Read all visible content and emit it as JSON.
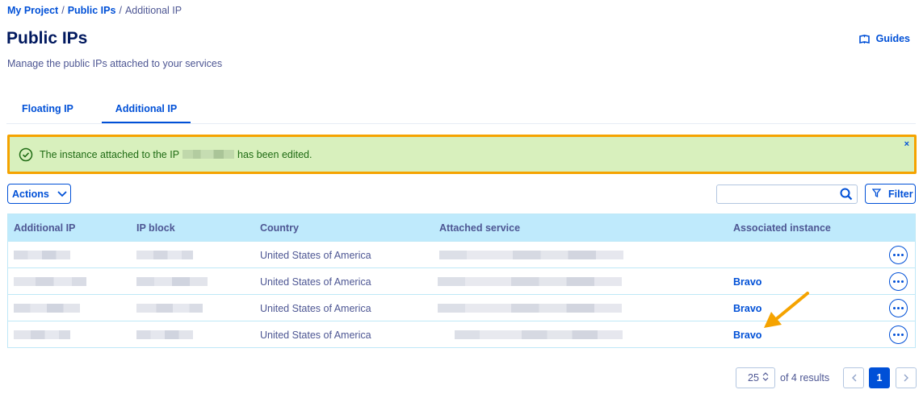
{
  "breadcrumb": {
    "items": [
      "My Project",
      "Public IPs"
    ],
    "current": "Additional IP",
    "separator": "/"
  },
  "page": {
    "title": "Public IPs",
    "subtitle": "Manage the public IPs attached to your services"
  },
  "guides": {
    "label": "Guides",
    "icon": "book-icon"
  },
  "tabs": [
    {
      "label": "Floating IP",
      "active": false
    },
    {
      "label": "Additional IP",
      "active": true
    }
  ],
  "alert": {
    "text_before": "The instance attached to the IP",
    "text_after": "has been edited.",
    "close": "×",
    "icon": "check-circle-icon",
    "highlight_color": "#f5a300"
  },
  "toolbar": {
    "actions_label": "Actions",
    "filter_label": "Filter",
    "search_placeholder": ""
  },
  "table": {
    "headers": [
      "Additional IP",
      "IP block",
      "Country",
      "Attached service",
      "Associated instance"
    ],
    "rows": [
      {
        "country": "United States of America",
        "instance": ""
      },
      {
        "country": "United States of America",
        "instance": "Bravo"
      },
      {
        "country": "United States of America",
        "instance": "Bravo"
      },
      {
        "country": "United States of America",
        "instance": "Bravo"
      }
    ]
  },
  "pagination": {
    "page_size": "25",
    "results": "of 4 results",
    "current_page": "1"
  },
  "colors": {
    "accent": "#0050d7",
    "header_bg": "#bfeafc",
    "success_bg": "#d8f0bd",
    "annotation": "#f5a300"
  }
}
